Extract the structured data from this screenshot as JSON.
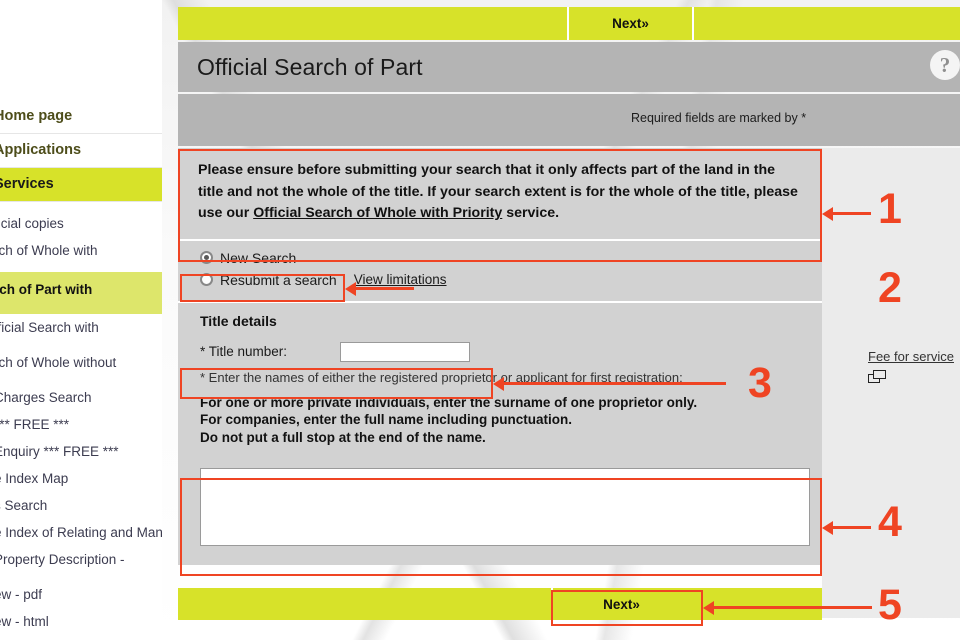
{
  "sidebar": {
    "items": [
      {
        "label": "Home page",
        "type": "main",
        "selected": false
      },
      {
        "label": "Applications",
        "type": "main",
        "selected": false
      },
      {
        "label": "Services",
        "type": "main",
        "selected": true
      },
      {
        "label": "ficial copies",
        "type": "sub",
        "highlight": false
      },
      {
        "label": "rch of Whole with",
        "type": "sub",
        "highlight": false
      },
      {
        "label": "rch of Part with",
        "type": "sub",
        "highlight": true
      },
      {
        "label": "fficial Search with",
        "type": "sub",
        "highlight": false
      },
      {
        "label": "rch of Whole without",
        "type": "sub",
        "highlight": false
      },
      {
        "label": "Charges Search",
        "type": "sub",
        "highlight": false
      },
      {
        "label": "*** FREE ***",
        "type": "sub",
        "highlight": false
      },
      {
        "label": "Enquiry *** FREE ***",
        "type": "sub",
        "highlight": false
      },
      {
        "label": "e Index Map",
        "type": "sub",
        "highlight": false
      },
      {
        "label": "s Search",
        "type": "sub",
        "highlight": false
      },
      {
        "label": "e Index of Relating and Manors",
        "type": "sub",
        "highlight": false
      },
      {
        "label": "Property Description -",
        "type": "sub",
        "highlight": false
      },
      {
        "label": "ew - pdf",
        "type": "sub",
        "highlight": false
      },
      {
        "label": "ew - html",
        "type": "sub",
        "highlight": false
      }
    ]
  },
  "topbar": {
    "next_label": "Next»"
  },
  "header": {
    "title": "Official Search of Part",
    "help_icon": "question-mark-icon",
    "required_note": "Required fields are marked by *"
  },
  "notice": {
    "text_before": "Please ensure before submitting your search that it only affects part of the land in the title and not the whole of the title. If your search extent is for the ",
    "text_mid": "whole of the title, please use our ",
    "link": "Official Search of Whole with Priority",
    "text_after": " service."
  },
  "search_mode": {
    "options": [
      {
        "label": "New Search",
        "selected": true
      },
      {
        "label": "Resubmit a search",
        "selected": false
      }
    ],
    "view_limitations_link": "View limitations"
  },
  "title_details": {
    "heading": "Title details",
    "title_number_label": "* Title number:",
    "title_number_value": "",
    "title_number_placeholder": "",
    "names_note": "* Enter the names of either the registered proprietor or applicant for first registration:",
    "instructions": [
      "For one or more private individuals, enter the surname of one proprietor only.",
      "For companies, enter the full name including punctuation.",
      "Do not put a full stop at the end of the name."
    ],
    "names_value": "",
    "names_placeholder": ""
  },
  "right_panel": {
    "fee_link": "Fee for service",
    "popup_icon": "new-window-icon"
  },
  "bottom_bar": {
    "next_label": "Next»"
  },
  "annotations": {
    "accent_color": "#ef4423",
    "markers": [
      {
        "number": "1",
        "target": "notice-box"
      },
      {
        "number": "2",
        "target": "new-search-radio"
      },
      {
        "number": "3",
        "target": "title-number-field"
      },
      {
        "number": "4",
        "target": "names-textarea"
      },
      {
        "number": "5",
        "target": "bottom-next-button"
      }
    ]
  },
  "colors": {
    "accent_yellow": "#d7e229",
    "header_gray": "#b4b4b4",
    "form_gray": "#d2d2d2",
    "panel_gray": "#ebebeb",
    "annotation_red": "#ef4423"
  }
}
